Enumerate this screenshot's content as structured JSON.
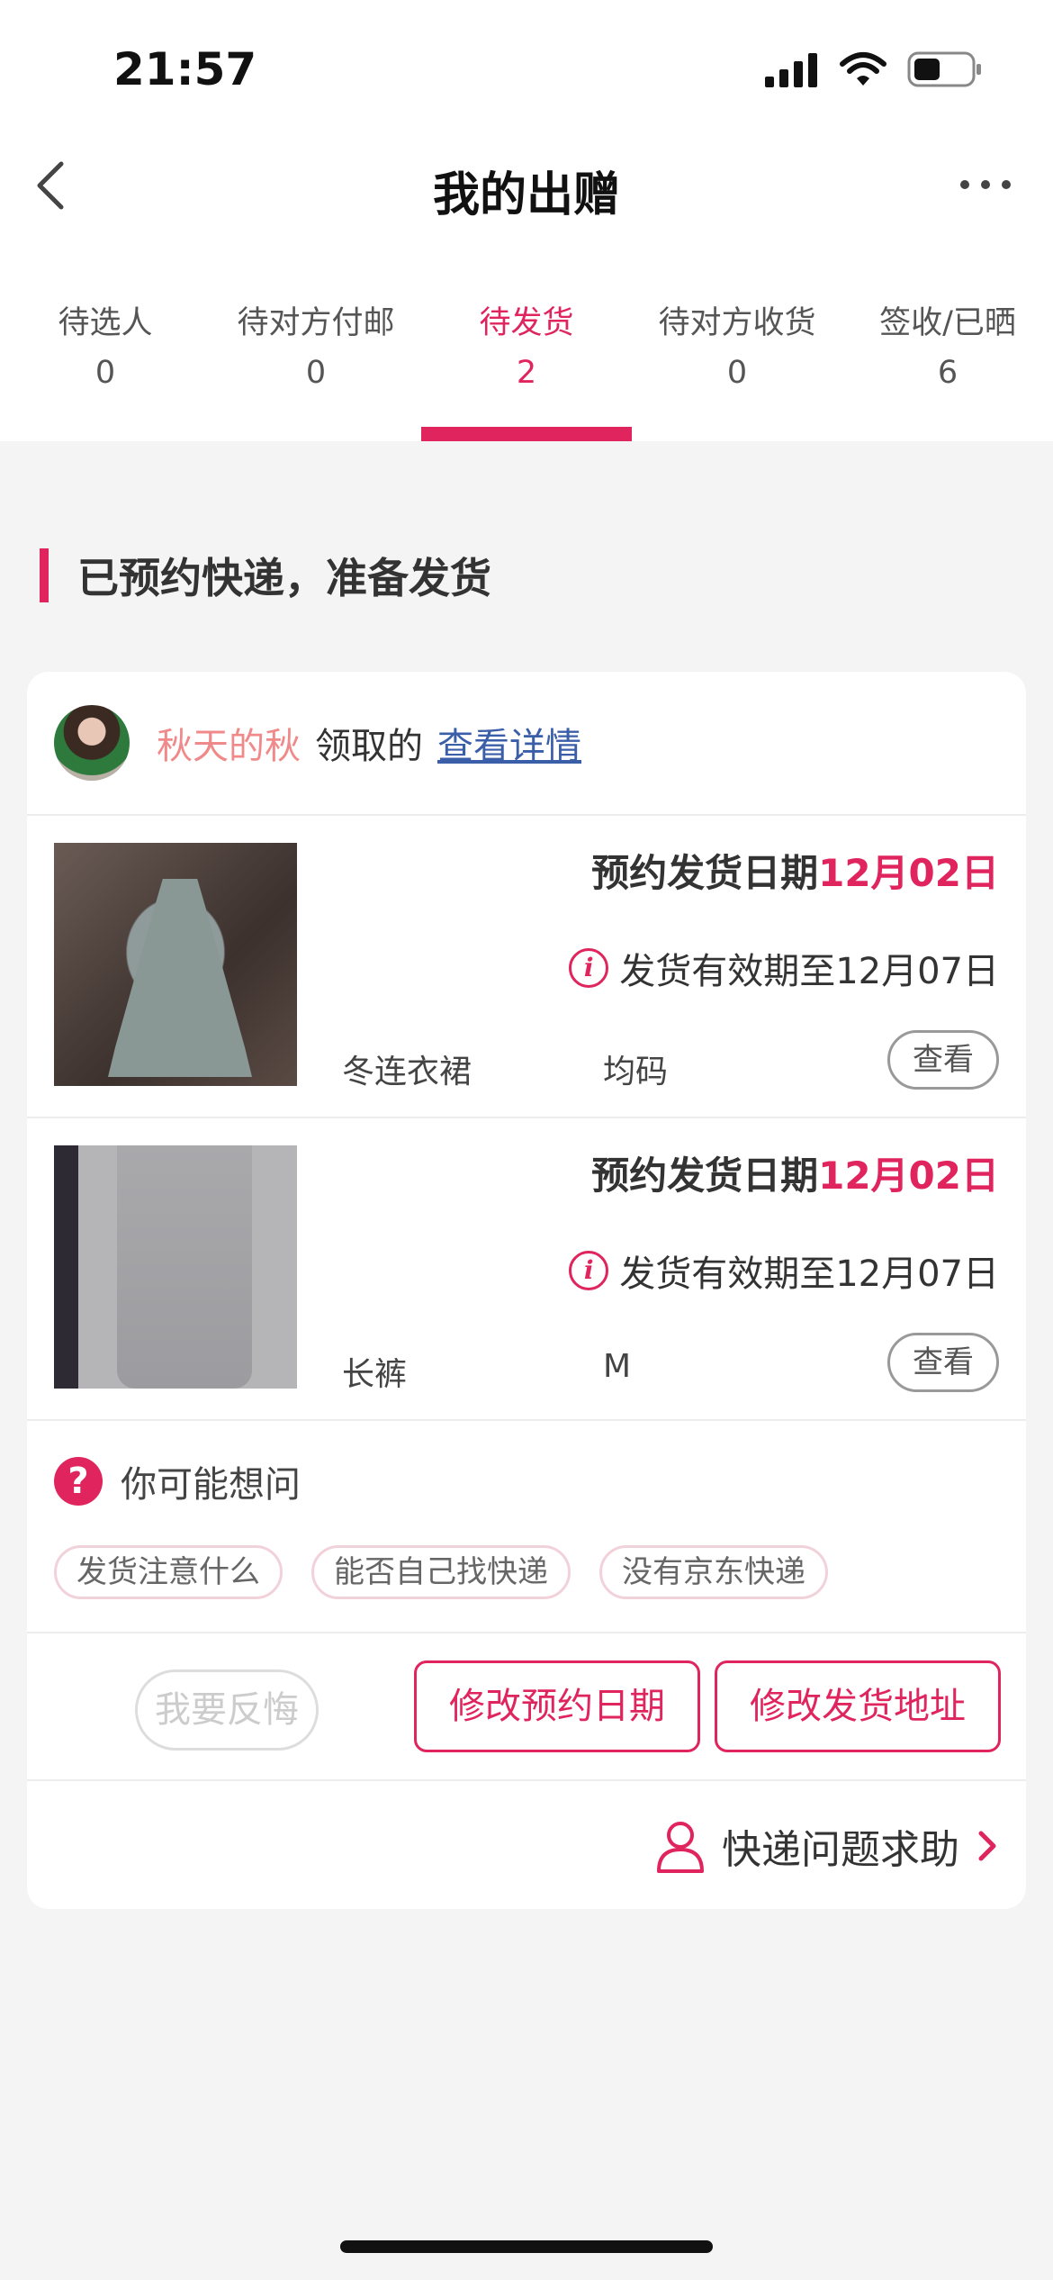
{
  "status": {
    "time": "21:57"
  },
  "nav": {
    "title": "我的出赠"
  },
  "tabs": [
    {
      "label": "待选人",
      "count": "0"
    },
    {
      "label": "待对方付邮",
      "count": "0"
    },
    {
      "label": "待发货",
      "count": "2"
    },
    {
      "label": "待对方收货",
      "count": "0"
    },
    {
      "label": "签收/已晒",
      "count": "6"
    }
  ],
  "active_tab": 2,
  "section": {
    "title": "已预约快递，准备发货"
  },
  "order": {
    "receiver_name": "秋天的秋",
    "receiver_suffix": "领取的",
    "detail_link": "查看详情",
    "items": [
      {
        "date_prefix": "预约发货日期",
        "date": "12月02日",
        "valid_text": "发货有效期至12月07日",
        "name": "冬连衣裙",
        "size": "均码",
        "view_label": "查看"
      },
      {
        "date_prefix": "预约发货日期",
        "date": "12月02日",
        "valid_text": "发货有效期至12月07日",
        "name": "长裤",
        "size": "M",
        "view_label": "查看"
      }
    ],
    "faq": {
      "title": "你可能想问",
      "chips": [
        "发货注意什么",
        "能否自己找快递",
        "没有京东快递"
      ]
    },
    "actions": {
      "regret": "我要反悔",
      "modify_date": "修改预约日期",
      "modify_address": "修改发货地址"
    },
    "help": {
      "label": "快递问题求助"
    }
  },
  "colors": {
    "accent": "#e0245e",
    "link": "#3b5ea8",
    "name": "#f08a8a"
  }
}
